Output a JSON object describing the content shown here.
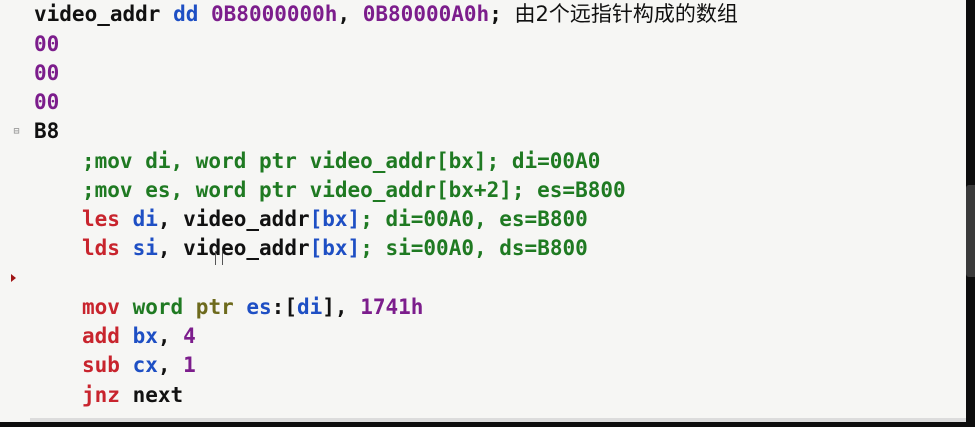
{
  "editor": {
    "fold_marker": "⊟",
    "lines": [
      {
        "tokens": [
          {
            "text": "video_addr ",
            "color": "black"
          },
          {
            "text": "dd ",
            "color": "blue"
          },
          {
            "text": "0B8000000h",
            "color": "purple"
          },
          {
            "text": ", ",
            "color": "black"
          },
          {
            "text": "0B80000A0h",
            "color": "purple"
          },
          {
            "text": "; ",
            "color": "black"
          },
          {
            "text": "由2个远指针构成的数组",
            "color": "cn"
          }
        ]
      },
      {
        "tokens": [
          {
            "text": "00",
            "color": "purple"
          }
        ]
      },
      {
        "tokens": [
          {
            "text": "00",
            "color": "purple"
          }
        ]
      },
      {
        "tokens": [
          {
            "text": "00",
            "color": "purple"
          }
        ]
      },
      {
        "tokens": [
          {
            "text": "B8",
            "color": "black"
          }
        ]
      },
      {
        "tokens": [
          {
            "text": ";mov di, word ptr video_addr[bx]; di=00A0",
            "color": "green"
          }
        ]
      },
      {
        "tokens": [
          {
            "text": ";mov es, word ptr video_addr[bx+2]; es=B800",
            "color": "green"
          }
        ]
      },
      {
        "tokens": [
          {
            "text": "les ",
            "color": "red"
          },
          {
            "text": "di",
            "color": "blue"
          },
          {
            "text": ", ",
            "color": "black"
          },
          {
            "text": "video_addr",
            "color": "black"
          },
          {
            "text": "[bx]",
            "color": "blue"
          },
          {
            "text": "; di=00A0, es=B800",
            "color": "green"
          }
        ]
      },
      {
        "tokens": [
          {
            "text": "lds ",
            "color": "red"
          },
          {
            "text": "si",
            "color": "blue"
          },
          {
            "text": ", ",
            "color": "black"
          },
          {
            "text": "video_addr",
            "color": "black"
          },
          {
            "text": "[bx]",
            "color": "blue"
          },
          {
            "text": "; si=00A0, ds=B800",
            "color": "green"
          }
        ]
      },
      {
        "tokens": []
      },
      {
        "tokens": [
          {
            "text": "mov ",
            "color": "red"
          },
          {
            "text": "word ",
            "color": "green"
          },
          {
            "text": "ptr ",
            "color": "olive"
          },
          {
            "text": "es",
            "color": "blue"
          },
          {
            "text": ":[",
            "color": "black"
          },
          {
            "text": "di",
            "color": "blue"
          },
          {
            "text": "], ",
            "color": "black"
          },
          {
            "text": "1741h",
            "color": "purple"
          }
        ]
      },
      {
        "tokens": [
          {
            "text": "add ",
            "color": "red"
          },
          {
            "text": "bx",
            "color": "blue"
          },
          {
            "text": ", ",
            "color": "black"
          },
          {
            "text": "4",
            "color": "purple"
          }
        ]
      },
      {
        "tokens": [
          {
            "text": "sub ",
            "color": "red"
          },
          {
            "text": "cx",
            "color": "blue"
          },
          {
            "text": ", ",
            "color": "black"
          },
          {
            "text": "1",
            "color": "purple"
          }
        ]
      },
      {
        "tokens": [
          {
            "text": "jnz ",
            "color": "red"
          },
          {
            "text": "next",
            "color": "black"
          }
        ]
      }
    ]
  }
}
